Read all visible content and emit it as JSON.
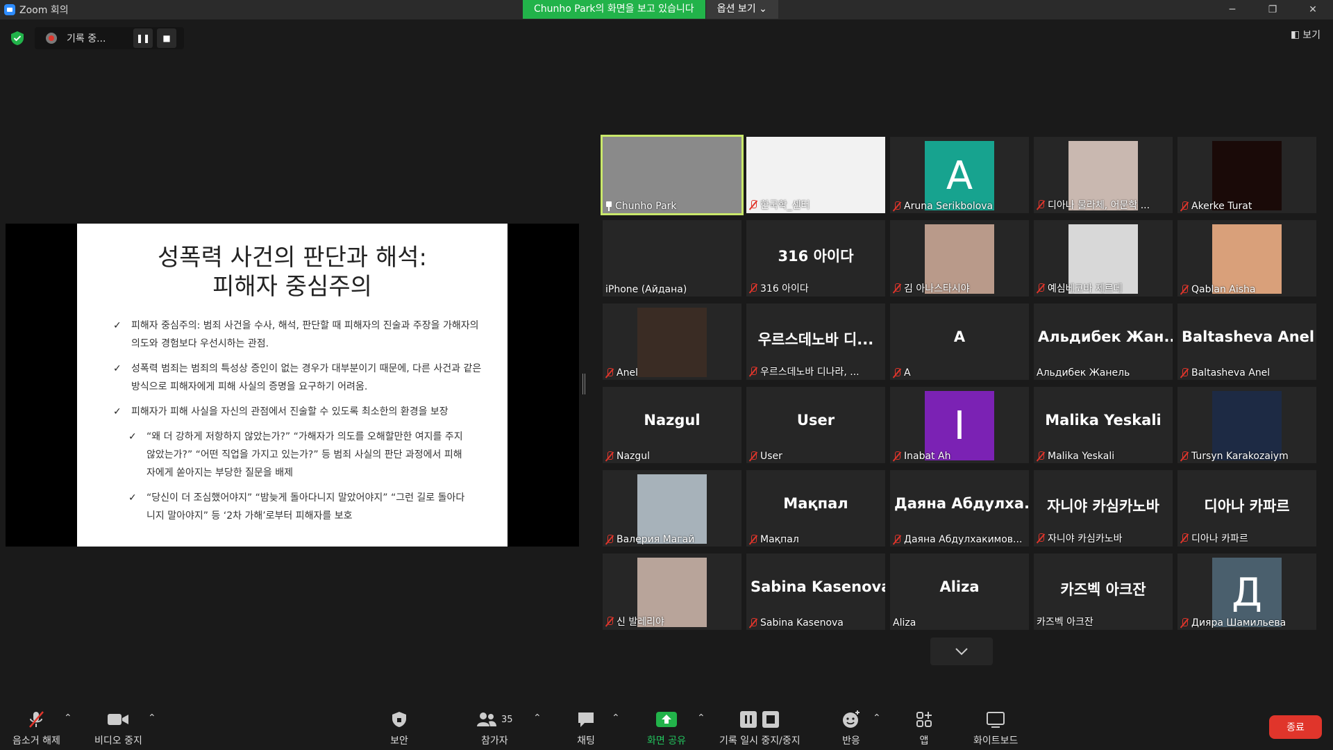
{
  "window": {
    "title": "Zoom 회의"
  },
  "share_banner": {
    "text": "Chunho Park의 화면을 보고 있습니다",
    "options": "옵션 보기 ⌄"
  },
  "recording": {
    "label": "기록 중..."
  },
  "view_label": "보기",
  "slide": {
    "title_line1": "성폭력 사건의 판단과 해석:",
    "title_line2": "피해자 중심주의",
    "bullets": [
      "피해자 중심주의: 범죄 사건을 수사, 해석, 판단할 때 피해자의 진술과 주장을 가해자의 의도와 경험보다 우선시하는 관점.",
      "성폭력 범죄는 범죄의 특성상 증인이 없는 경우가 대부분이기 때문에, 다른 사건과 같은 방식으로 피해자에게 피해 사실의 증명을 요구하기 어려움.",
      "피해자가 피해 사실을 자신의 관점에서 진술할 수 있도록 최소한의 환경을 보장",
      "“왜 더 강하게 저항하지 않았는가?” “가해자가 의도를 오해할만한 여지를 주지 않았는가?” “어떤 직업을 가지고 있는가?” 등 범죄 사실의 판단 과정에서 피해자에게 쏟아지는 부당한 질문을 배제",
      "“당신이 더 조심했어야지” “밤늦게 돌아다니지 말았어야지” “그런 길로 돌아다니지 말아야지” 등 ‘2차 가해’로부터 피해자를 보호"
    ]
  },
  "participants": [
    {
      "name": "Chunho Park",
      "big": "",
      "kind": "video",
      "color": "#8a8a8a",
      "muted": false,
      "pinned": true,
      "active": true
    },
    {
      "name": "한국학_센터",
      "big": "",
      "kind": "video",
      "color": "#f2f2f2",
      "muted": true
    },
    {
      "name": "Aruna Serikbolova",
      "big": "",
      "kind": "letter",
      "letter": "A",
      "color": "#17a38f",
      "muted": true
    },
    {
      "name": "디아나 물라체, 어문학 ...",
      "big": "",
      "kind": "video",
      "color": "#c9b8b0",
      "muted": true
    },
    {
      "name": "Akerke Turat",
      "big": "",
      "kind": "video",
      "color": "#1a0a08",
      "muted": true
    },
    {
      "name": "iPhone (Айдана)",
      "big": "",
      "kind": "none",
      "muted": false
    },
    {
      "name": "316 아이다",
      "big": "316 아이다",
      "kind": "text",
      "muted": true
    },
    {
      "name": "김 아나스타시야",
      "big": "",
      "kind": "video",
      "color": "#b99a8a",
      "muted": true
    },
    {
      "name": "예심베코바 제르데",
      "big": "",
      "kind": "video",
      "color": "#d8d8d8",
      "muted": true
    },
    {
      "name": "Qablan Aisha",
      "big": "",
      "kind": "video",
      "color": "#d9a07a",
      "muted": true
    },
    {
      "name": "Anel",
      "big": "",
      "kind": "video",
      "color": "#3a2c24",
      "muted": true
    },
    {
      "name": "우르스데노바 디나라, ...",
      "big": "우르스데노바 디...",
      "kind": "text",
      "muted": true
    },
    {
      "name": "A",
      "big": "A",
      "kind": "text",
      "muted": true
    },
    {
      "name": "Альдибек Жанель",
      "big": "Альдибек Жан...",
      "kind": "text",
      "muted": false
    },
    {
      "name": "Baltasheva Anel",
      "big": "Baltasheva Anel",
      "kind": "text",
      "muted": true
    },
    {
      "name": "Nazgul",
      "big": "Nazgul",
      "kind": "text",
      "muted": true
    },
    {
      "name": "User",
      "big": "User",
      "kind": "text",
      "muted": true
    },
    {
      "name": "Inabat Ah",
      "big": "",
      "kind": "letter",
      "letter": "I",
      "color": "#7b22b4",
      "muted": true
    },
    {
      "name": "Malika Yeskali",
      "big": "Malika Yeskali",
      "kind": "text",
      "muted": true
    },
    {
      "name": "Tursyn Karakozaiym",
      "big": "",
      "kind": "video",
      "color": "#1d2a44",
      "muted": true
    },
    {
      "name": "Валерия Магай",
      "big": "",
      "kind": "video",
      "color": "#a7b2ba",
      "muted": true
    },
    {
      "name": "Мақпал",
      "big": "Мақпал",
      "kind": "text",
      "muted": true
    },
    {
      "name": "Даяна Абдулхакимов...",
      "big": "Даяна Абдулха...",
      "kind": "text",
      "muted": true
    },
    {
      "name": "자니야 카심카노바",
      "big": "자니야 카심카노바",
      "kind": "text",
      "muted": true
    },
    {
      "name": "디아나 카파르",
      "big": "디아나 카파르",
      "kind": "text",
      "muted": true
    },
    {
      "name": "신 발레리야",
      "big": "",
      "kind": "video",
      "color": "#b8a49a",
      "muted": true
    },
    {
      "name": "Sabina Kasenova",
      "big": "Sabina Kasenova",
      "kind": "text",
      "muted": true
    },
    {
      "name": "Aliza",
      "big": "Aliza",
      "kind": "text",
      "muted": false
    },
    {
      "name": "카즈벡 아크잔",
      "big": "카즈벡 아크잔",
      "kind": "text",
      "muted": false
    },
    {
      "name": "Диярa Шамильева",
      "big": "",
      "kind": "letter",
      "letter": "Д",
      "color": "#4a5f6d",
      "muted": true
    }
  ],
  "toolbar": {
    "unmute": "음소거 해제",
    "video": "비디오 중지",
    "security": "보안",
    "participants": "참가자",
    "participants_count": "35",
    "chat": "채팅",
    "share": "화면 공유",
    "pause_rec": "기록 일시 중지/중지",
    "reactions": "반응",
    "apps": "앱",
    "whiteboard": "화이트보드",
    "end": "종료"
  },
  "colors": {
    "share_green": "#22b34a",
    "end_red": "#e0352b",
    "active_border": "#c9e86a"
  }
}
